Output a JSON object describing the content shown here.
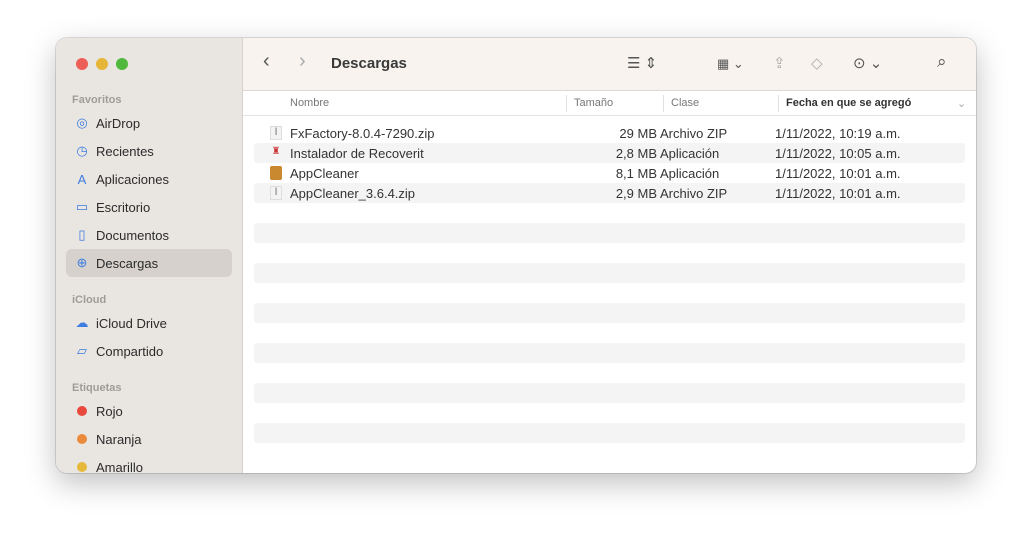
{
  "window": {
    "title": "Descargas"
  },
  "sidebar": {
    "favorites_label": "Favoritos",
    "favorites": [
      {
        "label": "AirDrop",
        "icon": "airdrop-icon",
        "glyph": "◎"
      },
      {
        "label": "Recientes",
        "icon": "clock-icon",
        "glyph": "◷"
      },
      {
        "label": "Aplicaciones",
        "icon": "apps-icon",
        "glyph": "A"
      },
      {
        "label": "Escritorio",
        "icon": "desktop-icon",
        "glyph": "▭"
      },
      {
        "label": "Documentos",
        "icon": "document-icon",
        "glyph": "▯"
      },
      {
        "label": "Descargas",
        "icon": "download-icon",
        "glyph": "⊕"
      }
    ],
    "icloud_label": "iCloud",
    "icloud": [
      {
        "label": "iCloud Drive",
        "icon": "cloud-icon",
        "glyph": "☁"
      },
      {
        "label": "Compartido",
        "icon": "shared-folder-icon",
        "glyph": "▱"
      }
    ],
    "tags_label": "Etiquetas",
    "tags": [
      {
        "label": "Rojo",
        "color": "#e9493d"
      },
      {
        "label": "Naranja",
        "color": "#ea8a3c"
      },
      {
        "label": "Amarillo",
        "color": "#e7b93a"
      }
    ]
  },
  "columns": {
    "name": "Nombre",
    "size": "Tamaño",
    "kind": "Clase",
    "date": "Fecha en que se agregó"
  },
  "files": [
    {
      "name": "FxFactory-8.0.4-7290.zip",
      "size": "29 MB",
      "kind": "Archivo ZIP",
      "date": "1/11/2022, 10:19 a.m.",
      "icon": "zip-file-icon"
    },
    {
      "name": "Instalador de Recoverit",
      "size": "2,8 MB",
      "kind": "Aplicación",
      "date": "1/11/2022, 10:05 a.m.",
      "icon": "app-icon"
    },
    {
      "name": "AppCleaner",
      "size": "8,1 MB",
      "kind": "Aplicación",
      "date": "1/11/2022, 10:01 a.m.",
      "icon": "app-icon"
    },
    {
      "name": "AppCleaner_3.6.4.zip",
      "size": "2,9 MB",
      "kind": "Archivo ZIP",
      "date": "1/11/2022, 10:01 a.m.",
      "icon": "zip-file-icon"
    }
  ]
}
